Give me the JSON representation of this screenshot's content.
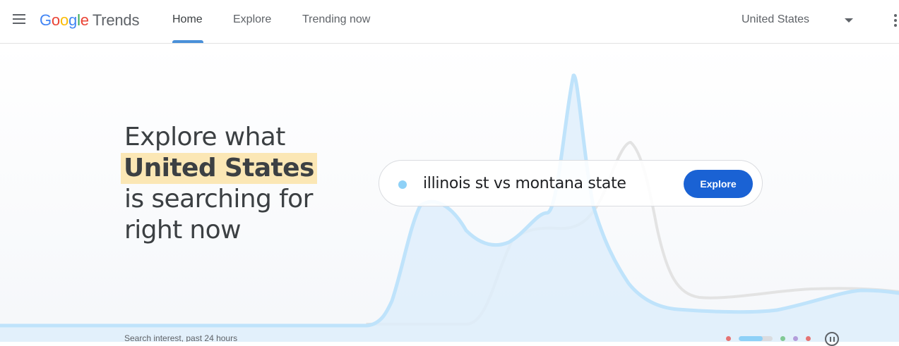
{
  "header": {
    "logo": {
      "google": [
        "G",
        "o",
        "o",
        "g",
        "l",
        "e"
      ],
      "product": "Trends"
    },
    "tabs": [
      {
        "label": "Home",
        "active": true
      },
      {
        "label": "Explore",
        "active": false
      },
      {
        "label": "Trending now",
        "active": false
      }
    ],
    "region": "United States"
  },
  "hero": {
    "headline_1": "Explore what",
    "headline_highlight": "United States",
    "headline_2": "is searching for",
    "headline_3": "right now",
    "search_term": "illinois st vs montana state",
    "explore_label": "Explore",
    "caption": "Search interest, past 24 hours"
  },
  "colors": {
    "accent_blue": "#1a62d4",
    "series_primary": "#8ed1f7",
    "series_secondary": "#e0e0e0",
    "highlight": "#fbe7b5"
  },
  "carousel": {
    "dots": [
      "#e57373",
      "#8ed1f7",
      "#81c995",
      "#b39ddb",
      "#e57373"
    ],
    "active_index": 1,
    "control": "pause-icon"
  }
}
